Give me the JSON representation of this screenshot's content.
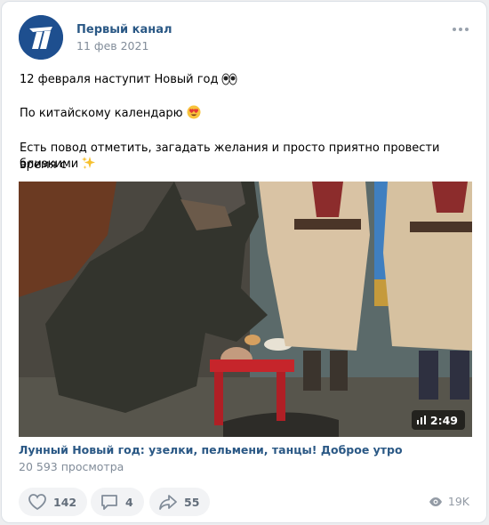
{
  "post": {
    "author": "Первый канал",
    "date": "11 фев 2021",
    "text_lines": [
      "12 февраля наступит Новый год",
      "По китайскому календарю",
      "Есть повод отметить, загадать желания и просто приятно провести время с",
      "близкими"
    ],
    "emojis": [
      "eyes-emoji",
      "heart-eyes-emoji",
      "sparkles-emoji"
    ]
  },
  "video": {
    "duration": "2:49",
    "title": "Лунный Новый год: узелки, пельмени, танцы! Доброе утро",
    "views": "20 593 просмотра"
  },
  "actions": {
    "likes": "142",
    "comments": "4",
    "shares": "55",
    "views": "19K"
  },
  "colors": {
    "link": "#2a5885",
    "secondary": "#818c99",
    "action_bg": "#f2f3f5",
    "action_text": "#626d7a",
    "avatar_bg": "#1e4f8f"
  },
  "icons": [
    "channel-one-logo-icon",
    "more-icon",
    "video-bars-icon",
    "like-icon",
    "comment-icon",
    "share-icon",
    "views-eye-icon"
  ]
}
